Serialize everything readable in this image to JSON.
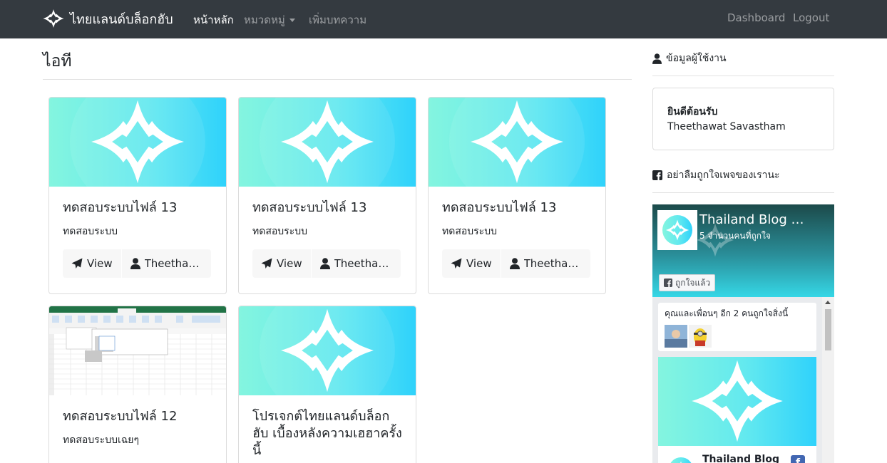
{
  "navbar": {
    "brand": "ไทยแลนด์บล็อกฮับ",
    "links": [
      "หน้าหลัก",
      "หมวดหมู่",
      "เพิ่มบทความ"
    ],
    "right_links": [
      "Dashboard",
      "Logout"
    ]
  },
  "page": {
    "title": "ไอที"
  },
  "cards": [
    {
      "title": "ทดสอบระบบไฟล์ 13",
      "text": "ทดสอบระบบ",
      "view_label": "View",
      "author": "Theethawat Savastham",
      "author_short": "Theethaw..."
    },
    {
      "title": "ทดสอบระบบไฟล์ 13",
      "text": "ทดสอบระบบ",
      "view_label": "View",
      "author": "Theethawat Savastham",
      "author_short": "Theethaw..."
    },
    {
      "title": "ทดสอบระบบไฟล์ 13",
      "text": "ทดสอบระบบ",
      "view_label": "View",
      "author": "Theethawat Savastham",
      "author_short": "Theethaw..."
    },
    {
      "title": "ทดสอบระบบไฟล์ 12",
      "text": "ทดสอบระบบเฉยๆ"
    },
    {
      "title": "โปรเจกต์ไทยแลนด์บล็อกฮับ เบื้องหลังความเฮฮาครั้งนี้"
    }
  ],
  "sidebar": {
    "user_heading": "ข้อมูลผู้ใช้งาน",
    "welcome": "ยินดีต้อนรับ",
    "username": "Theethawat Savastham",
    "fb_heading": "อย่าลืมถูกใจเพจของเรานะ",
    "fb": {
      "page_name": "Thailand Blog …",
      "count_text": "5 จำนวนคนที่ถูกใจ",
      "like_button": "ถูกใจแล้ว",
      "friends_text": "คุณและเพื่อนๆ อีก 2 คนถูกใจสิ่งนี้",
      "post_name": "Thailand Blog"
    }
  },
  "colors": {
    "navbar": "#343a40",
    "thumb_from": "#7ff5dc",
    "thumb_to": "#2fd3fb"
  }
}
